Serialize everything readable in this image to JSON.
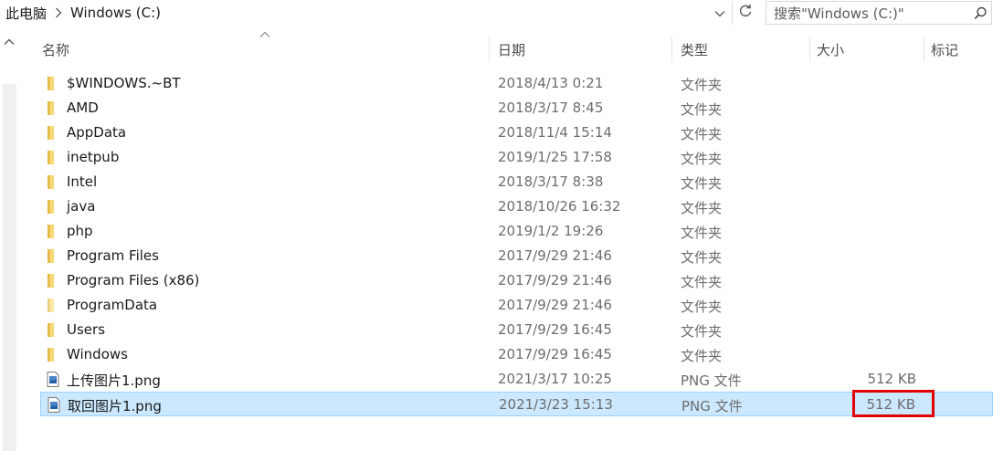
{
  "address": {
    "root": "此电脑",
    "current": "Windows (C:)"
  },
  "search": {
    "placeholder": "搜索\"Windows (C:)\""
  },
  "columns": {
    "name": "名称",
    "date": "日期",
    "type": "类型",
    "size": "大小",
    "tag": "标记"
  },
  "files": [
    {
      "name": "$WINDOWS.~BT",
      "date": "2018/4/13 0:21",
      "type": "文件夹",
      "size": "",
      "kind": "folder"
    },
    {
      "name": "AMD",
      "date": "2018/3/17 8:45",
      "type": "文件夹",
      "size": "",
      "kind": "folder"
    },
    {
      "name": "AppData",
      "date": "2018/11/4 15:14",
      "type": "文件夹",
      "size": "",
      "kind": "folder"
    },
    {
      "name": "inetpub",
      "date": "2019/1/25 17:58",
      "type": "文件夹",
      "size": "",
      "kind": "folder"
    },
    {
      "name": "Intel",
      "date": "2018/3/17 8:38",
      "type": "文件夹",
      "size": "",
      "kind": "folder"
    },
    {
      "name": "java",
      "date": "2018/10/26 16:32",
      "type": "文件夹",
      "size": "",
      "kind": "folder"
    },
    {
      "name": "php",
      "date": "2019/1/2 19:26",
      "type": "文件夹",
      "size": "",
      "kind": "folder"
    },
    {
      "name": "Program Files",
      "date": "2017/9/29 21:46",
      "type": "文件夹",
      "size": "",
      "kind": "folder"
    },
    {
      "name": "Program Files (x86)",
      "date": "2017/9/29 21:46",
      "type": "文件夹",
      "size": "",
      "kind": "folder"
    },
    {
      "name": "ProgramData",
      "date": "2017/9/29 21:46",
      "type": "文件夹",
      "size": "",
      "kind": "folder-light"
    },
    {
      "name": "Users",
      "date": "2017/9/29 16:45",
      "type": "文件夹",
      "size": "",
      "kind": "folder"
    },
    {
      "name": "Windows",
      "date": "2017/9/29 16:45",
      "type": "文件夹",
      "size": "",
      "kind": "folder"
    },
    {
      "name": "上传图片1.png",
      "date": "2021/3/17 10:25",
      "type": "PNG 文件",
      "size": "512 KB",
      "kind": "png"
    },
    {
      "name": "取回图片1.png",
      "date": "2021/3/23 15:13",
      "type": "PNG 文件",
      "size": "512 KB",
      "kind": "png",
      "selected": true
    }
  ],
  "icons": {
    "folder": "folder-icon",
    "png": "image-file-icon"
  },
  "colors": {
    "selection_bg": "#cce8ff",
    "selection_border": "#99d1ff",
    "folder_yellow": "#f8d775",
    "highlight_red": "#e00000"
  }
}
